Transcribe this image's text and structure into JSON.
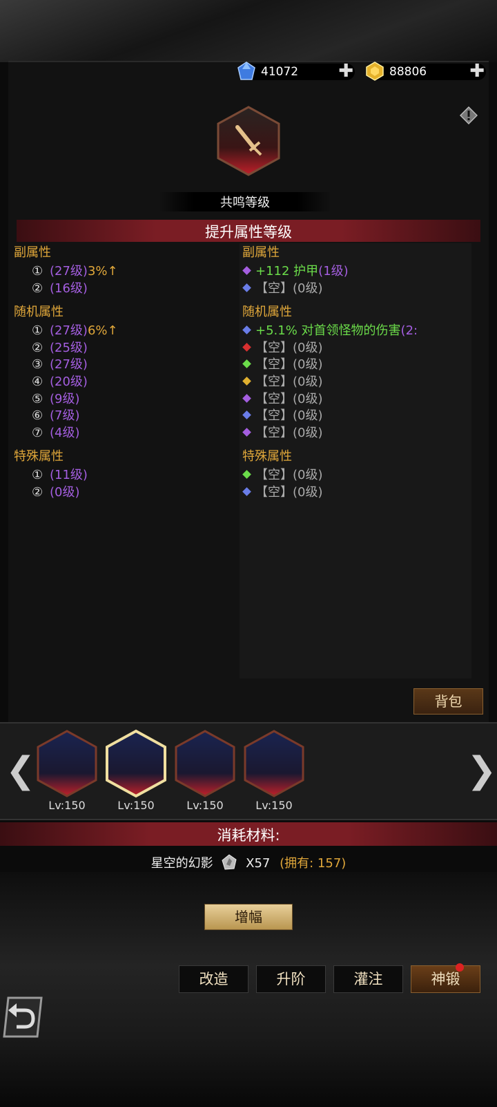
{
  "currency": [
    {
      "icon": "blue-gem-icon",
      "value": "41072"
    },
    {
      "icon": "gold-gem-icon",
      "value": "88806"
    }
  ],
  "resonance_label": "共鸣等级",
  "upgrade_title": "提升属性等级",
  "left": {
    "secondary": {
      "title": "副属性",
      "rows": [
        {
          "num": "①",
          "lv": "(27级)",
          "extra": "3%↑"
        },
        {
          "num": "②",
          "lv": "(16级)",
          "extra": ""
        }
      ]
    },
    "random": {
      "title": "随机属性",
      "rows": [
        {
          "num": "①",
          "lv": "(27级)",
          "extra": "6%↑"
        },
        {
          "num": "②",
          "lv": "(25级)",
          "extra": ""
        },
        {
          "num": "③",
          "lv": "(27级)",
          "extra": ""
        },
        {
          "num": "④",
          "lv": "(20级)",
          "extra": ""
        },
        {
          "num": "⑤",
          "lv": "(9级)",
          "extra": ""
        },
        {
          "num": "⑥",
          "lv": "(7级)",
          "extra": ""
        },
        {
          "num": "⑦",
          "lv": "(4级)",
          "extra": ""
        }
      ]
    },
    "special": {
      "title": "特殊属性",
      "rows": [
        {
          "num": "①",
          "lv": "(11级)",
          "extra": ""
        },
        {
          "num": "②",
          "lv": "(0级)",
          "extra": ""
        }
      ]
    }
  },
  "right": {
    "secondary": {
      "title": "副属性",
      "rows": [
        {
          "color": "#a45ee0",
          "main": "+112 护甲",
          "lv": "(1级)",
          "active": true
        },
        {
          "color": "#6a7de8",
          "main": "【空】",
          "lv": "(0级)",
          "active": false
        }
      ]
    },
    "random": {
      "title": "随机属性",
      "rows": [
        {
          "color": "#6a7de8",
          "main": "+5.1% 对首领怪物的伤害",
          "lv": "(2:",
          "active": true
        },
        {
          "color": "#d83030",
          "main": "【空】",
          "lv": "(0级)",
          "active": false
        },
        {
          "color": "#6bdc4a",
          "main": "【空】",
          "lv": "(0级)",
          "active": false
        },
        {
          "color": "#e0b030",
          "main": "【空】",
          "lv": "(0级)",
          "active": false
        },
        {
          "color": "#a45ee0",
          "main": "【空】",
          "lv": "(0级)",
          "active": false
        },
        {
          "color": "#6a7de8",
          "main": "【空】",
          "lv": "(0级)",
          "active": false
        },
        {
          "color": "#a45ee0",
          "main": "【空】",
          "lv": "(0级)",
          "active": false
        }
      ]
    },
    "special": {
      "title": "特殊属性",
      "rows": [
        {
          "color": "#6bdc4a",
          "main": "【空】",
          "lv": "(0级)",
          "active": false
        },
        {
          "color": "#6a7de8",
          "main": "【空】",
          "lv": "(0级)",
          "active": false
        }
      ]
    }
  },
  "bag_label": "背包",
  "equipment": [
    {
      "name": "scythe-icon",
      "level": "Lv:150",
      "selected": false
    },
    {
      "name": "curved-blade-icon",
      "level": "Lv:150",
      "selected": true
    },
    {
      "name": "spear-icon",
      "level": "Lv:150",
      "selected": false
    },
    {
      "name": "horn-icon",
      "level": "Lv:150",
      "selected": false
    }
  ],
  "material": {
    "title": "消耗材料:",
    "name": "星空的幻影",
    "count": "X57",
    "owned": "(拥有: 157)"
  },
  "amplify_label": "增幅",
  "actions": [
    "改造",
    "升阶",
    "灌注",
    "神锻"
  ]
}
